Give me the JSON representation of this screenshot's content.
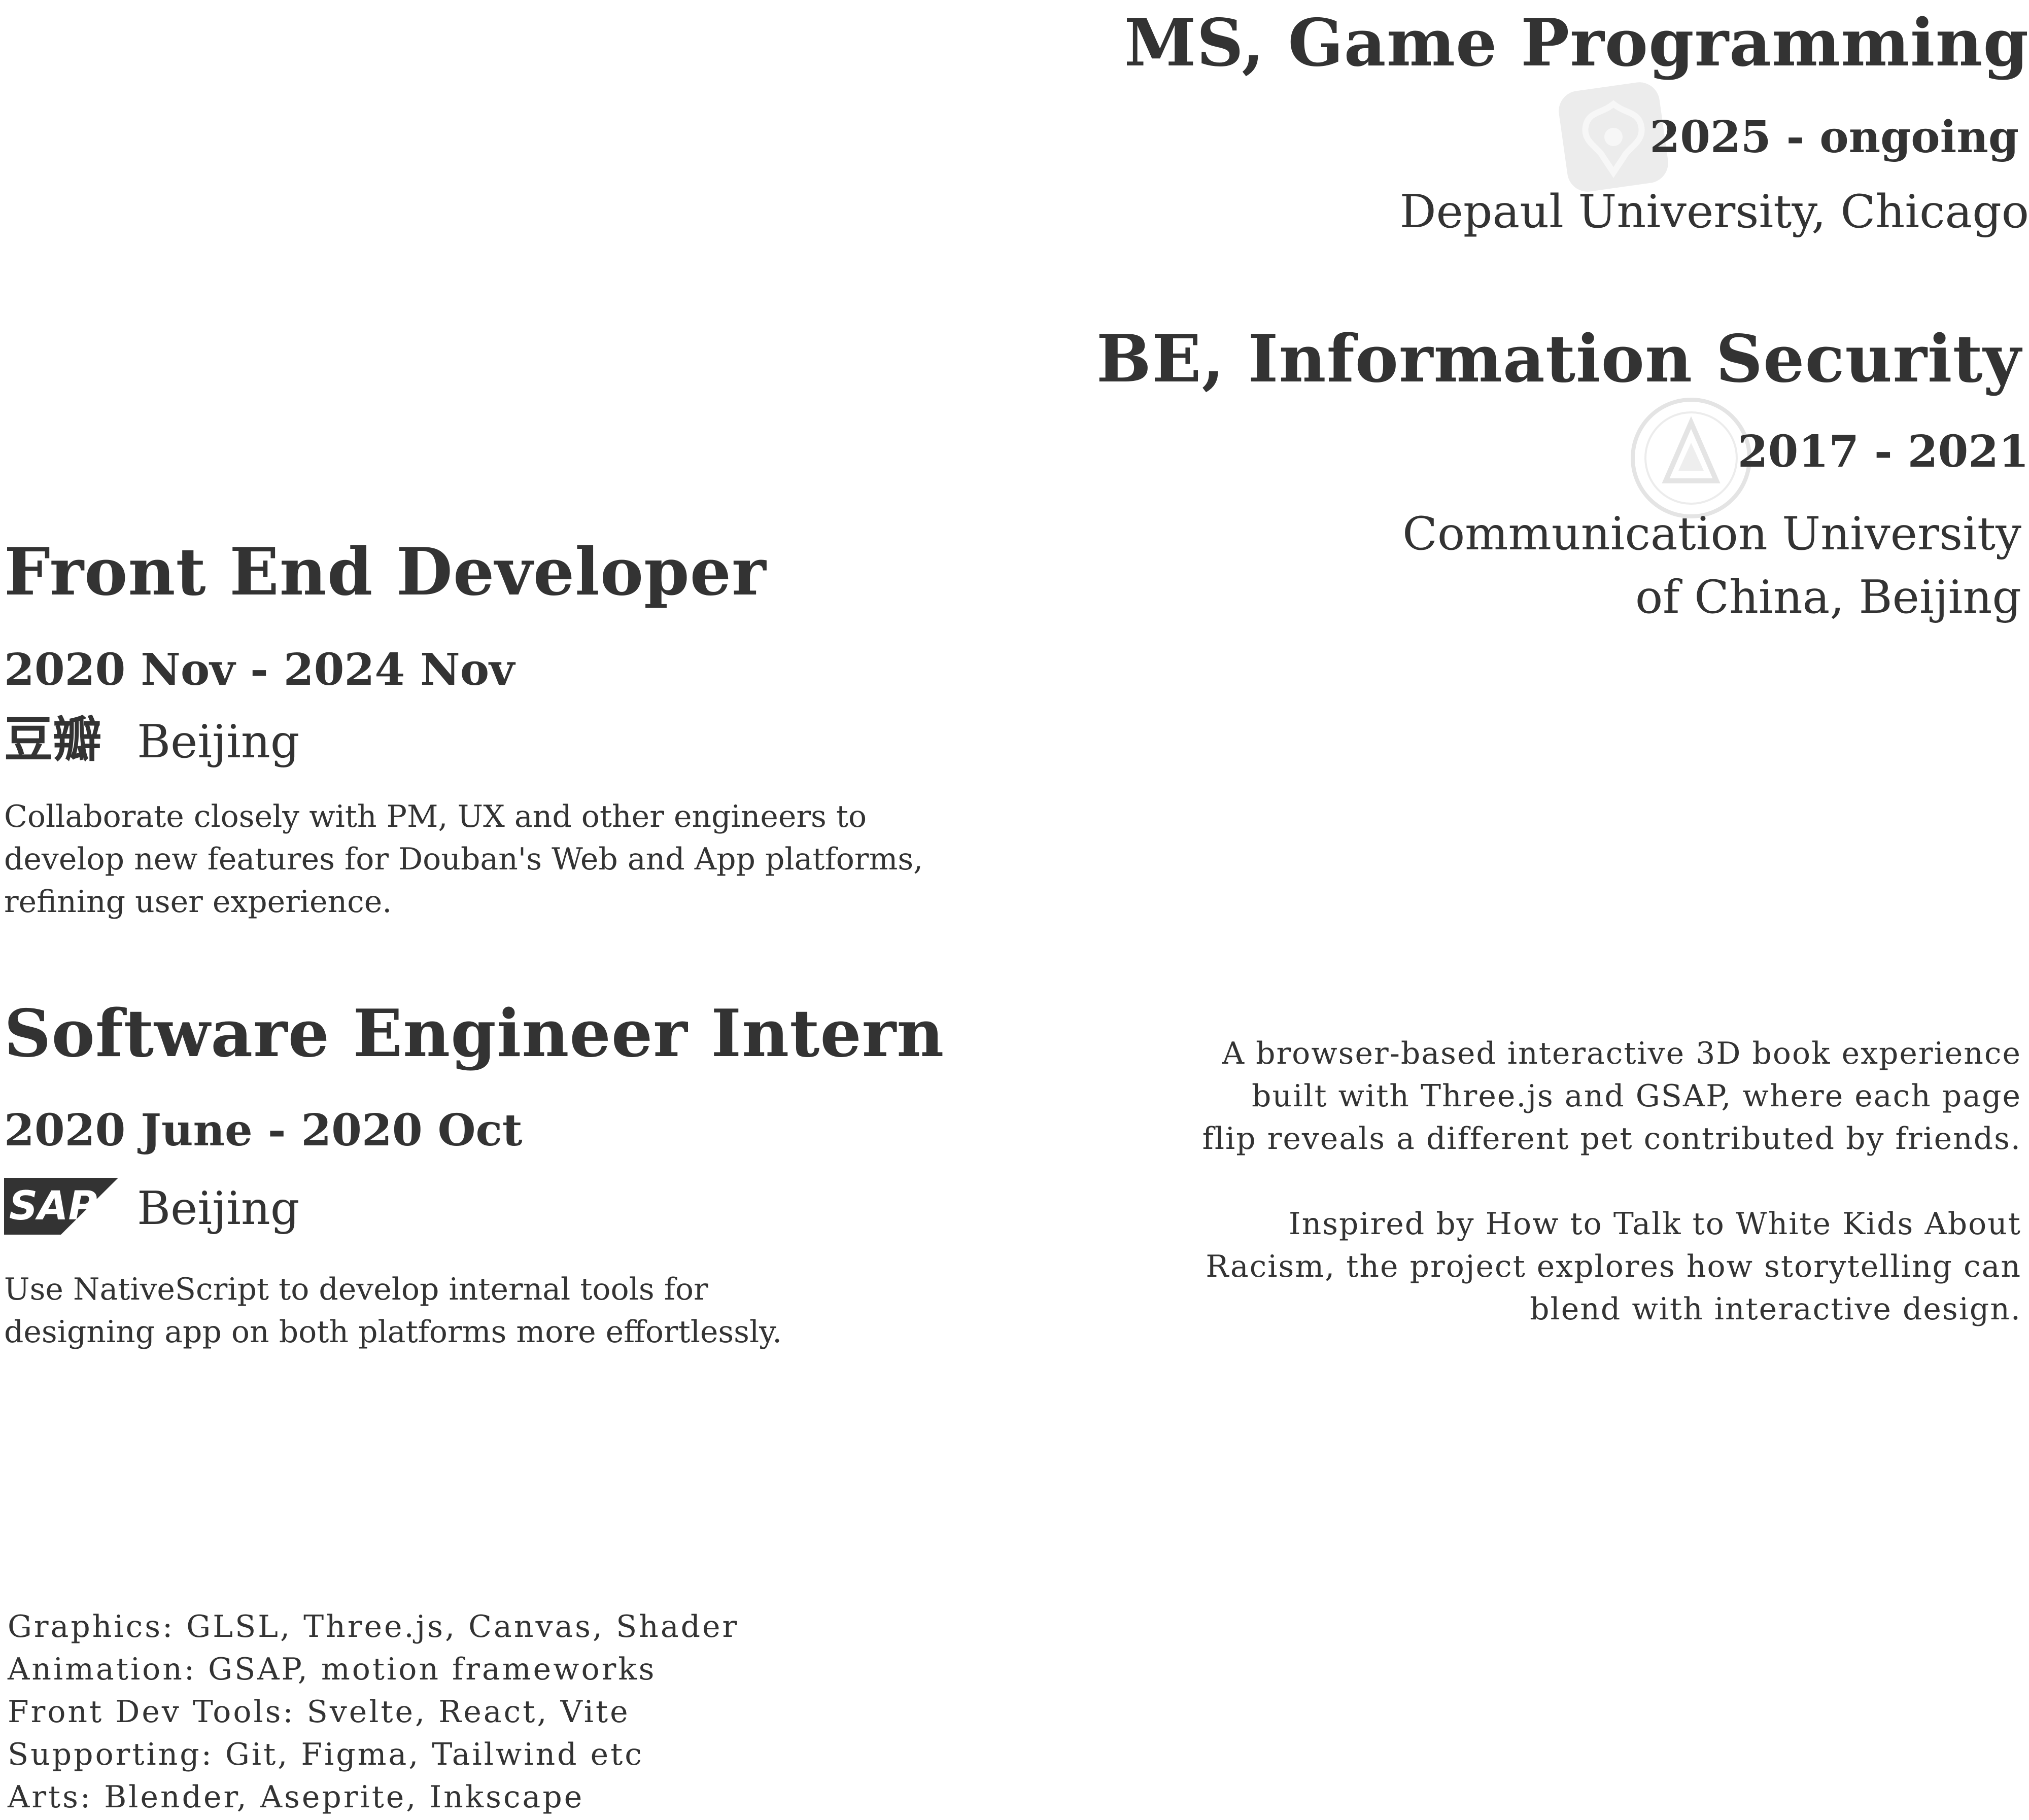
{
  "education": [
    {
      "degree": "MS, Game Programming",
      "dates": "2025 - ongoing",
      "school": "Depaul University, Chicago",
      "logo_icon": "depaul-emblem-icon"
    },
    {
      "degree": "BE, Information Security",
      "dates": "2017 - 2021",
      "school_line1": "Communication University",
      "school_line2": "of China, Beijing",
      "logo_icon": "cuc-seal-icon"
    }
  ],
  "experience": [
    {
      "role": "Front End Developer",
      "dates": "2020 Nov - 2024 Nov",
      "company_logo": "豆瓣",
      "location": "Beijing",
      "desc": [
        "Collaborate closely with PM, UX and other engineers to",
        "develop new features for Douban's Web and App platforms,",
        "refining user experience."
      ]
    },
    {
      "role": "Software Engineer Intern",
      "dates": "2020 June - 2020 Oct",
      "company_logo": "SAP",
      "location": "Beijing",
      "desc": [
        "Use NativeScript to develop internal tools for",
        "designing app on both platforms more effortlessly."
      ]
    }
  ],
  "project": {
    "para1": [
      "A browser-based interactive 3D book experience",
      "built with Three.js and GSAP, where each page",
      "flip reveals a different pet contributed by friends."
    ],
    "para2": [
      "Inspired by How to Talk to White Kids About",
      "Racism, the project explores how storytelling can",
      "blend with interactive design."
    ]
  },
  "skills": [
    "Graphics: GLSL, Three.js, Canvas, Shader",
    "Animation: GSAP, motion frameworks",
    "Front Dev Tools: Svelte, React, Vite",
    "Supporting: Git, Figma, Tailwind etc",
    "Arts: Blender, Aseprite, Inkscape"
  ],
  "colors": {
    "text": "#333333",
    "logo_faint": "#e6e6e6"
  }
}
